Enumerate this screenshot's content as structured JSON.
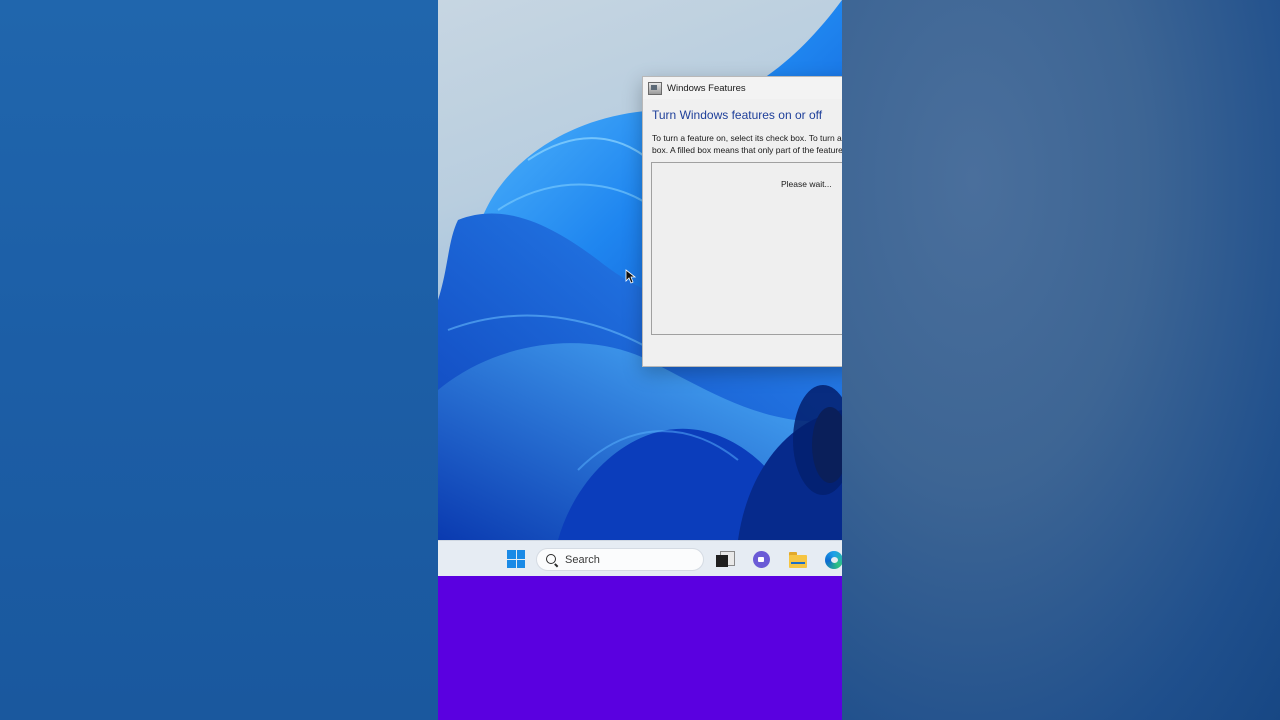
{
  "window": {
    "title": "Windows Features",
    "heading": "Turn Windows features on or off",
    "description_line1": "To turn a feature on, select its check box. To turn a feature off, clear its check",
    "description_line2": "box. A filled box means that only part of the feature is turned on.",
    "status": "Please wait..."
  },
  "taskbar": {
    "search_label": "Search",
    "icons": [
      "start-icon",
      "search-icon",
      "task-view-icon",
      "chat-icon",
      "file-explorer-icon",
      "edge-icon"
    ]
  },
  "colors": {
    "heading": "#1e3f9a",
    "purple_band": "#5a00e0",
    "backdrop_blue": "#1d5aa0"
  }
}
